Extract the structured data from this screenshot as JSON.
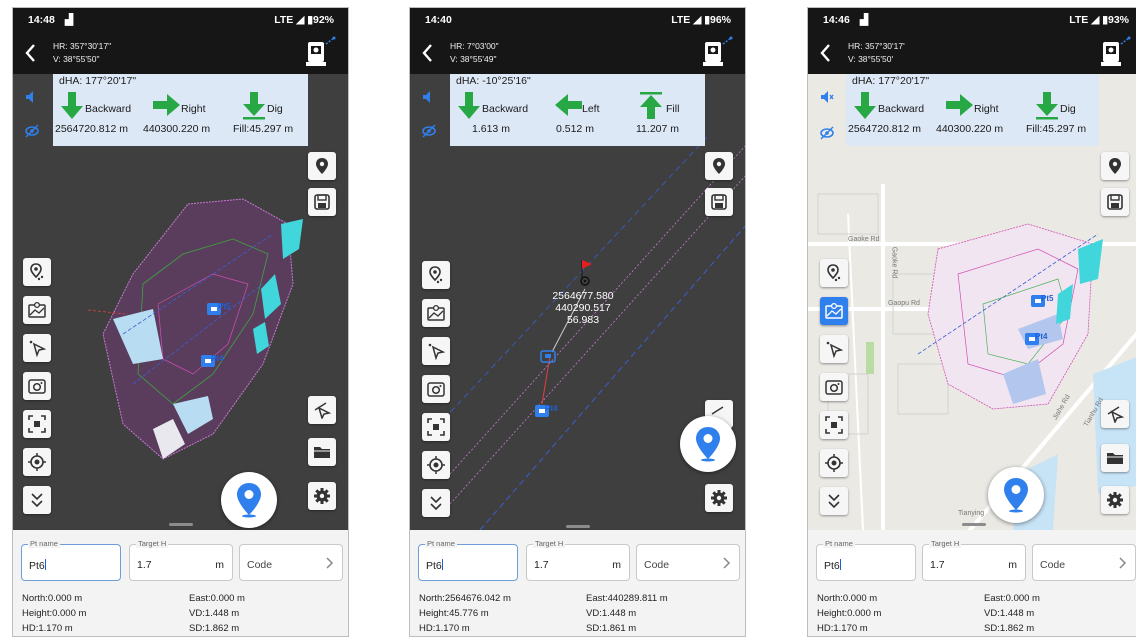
{
  "screens": [
    {
      "status": {
        "time": "14:48",
        "right": "LTE ◢ ▮92%"
      },
      "angles": {
        "hr": "HR: 357°30'17\"",
        "v": "V: 38°55'50\""
      },
      "guidance": {
        "dha": "dHA: 177°20'17\"",
        "items": [
          {
            "label": "Backward",
            "value": "2564720.812 m"
          },
          {
            "label": "Right",
            "value": "440300.220 m"
          },
          {
            "label": "Dig",
            "value": "Fill:45.297 m"
          }
        ]
      },
      "points": [
        "Pt5",
        "Pt4"
      ],
      "form": {
        "pt_label": "Pt name",
        "pt_value": "Pt6",
        "target_label": "Target H",
        "target_value": "1.7",
        "unit": "m",
        "code_placeholder": "Code"
      },
      "readouts": {
        "north": "North:0.000 m",
        "east": "East:0.000 m",
        "height": "Height:0.000 m",
        "vd": "VD:1.448 m",
        "hd": "HD:1.170 m",
        "sd": "SD:1.862 m"
      }
    },
    {
      "status": {
        "time": "14:40",
        "right": "LTE ◢ ▮96%"
      },
      "angles": {
        "hr": "HR: 7°03'00\"",
        "v": "V: 38°55'49\""
      },
      "guidance": {
        "dha": "dHA: -10°25'16\"",
        "items": [
          {
            "label": "Backward",
            "value": "1.613 m"
          },
          {
            "label": "Left",
            "value": "0.512 m"
          },
          {
            "label": "Fill",
            "value": "11.207 m"
          }
        ]
      },
      "points": [
        "Pt4"
      ],
      "target_coords": {
        "north": "2564677.580",
        "east": "440290.517",
        "height": "56.983"
      },
      "form": {
        "pt_label": "Pt name",
        "pt_value": "Pt6",
        "target_label": "Target H",
        "target_value": "1.7",
        "unit": "m",
        "code_placeholder": "Code"
      },
      "readouts": {
        "north": "North:2564676.042 m",
        "east": "East:440289.811 m",
        "height": "Height:45.776 m",
        "vd": "VD:1.448 m",
        "hd": "HD:1.170 m",
        "sd": "SD:1.861 m"
      }
    },
    {
      "status": {
        "time": "14:46",
        "right": "LTE ◢ ▮93%"
      },
      "angles": {
        "hr": "HR: 357°30'17'",
        "v": "V: 38°55'50'"
      },
      "guidance": {
        "dha": "dHA: 177°20'17\"",
        "items": [
          {
            "label": "Backward",
            "value": "2564720.812 m"
          },
          {
            "label": "Right",
            "value": "440300.220 m"
          },
          {
            "label": "Dig",
            "value": "Fill:45.297 m"
          }
        ]
      },
      "points": [
        "Pt5",
        "Pt4"
      ],
      "map_labels": [
        "Gaoke Rd",
        "Gaoke Rd",
        "Gaopu Rd",
        "Tianying",
        "Jiahe Rd",
        "Tianhu Rd"
      ],
      "form": {
        "pt_label": "Pt name",
        "pt_value": "Pt6",
        "target_label": "Target H",
        "target_value": "1.7",
        "unit": "m",
        "code_placeholder": "Code"
      },
      "readouts": {
        "north": "North:0.000 m",
        "east": "East:0.000 m",
        "height": "Height:0.000 m",
        "vd": "VD:1.448 m",
        "hd": "HD:1.170 m",
        "sd": "SD:1.862 m"
      }
    }
  ],
  "colors": {
    "accent": "#2f80ed",
    "arrow": "#28a745",
    "panel": "#dde8f6",
    "map_dark": "#3f3f3f",
    "map_light": "#ebe9e4",
    "statusbar": "#161616"
  }
}
